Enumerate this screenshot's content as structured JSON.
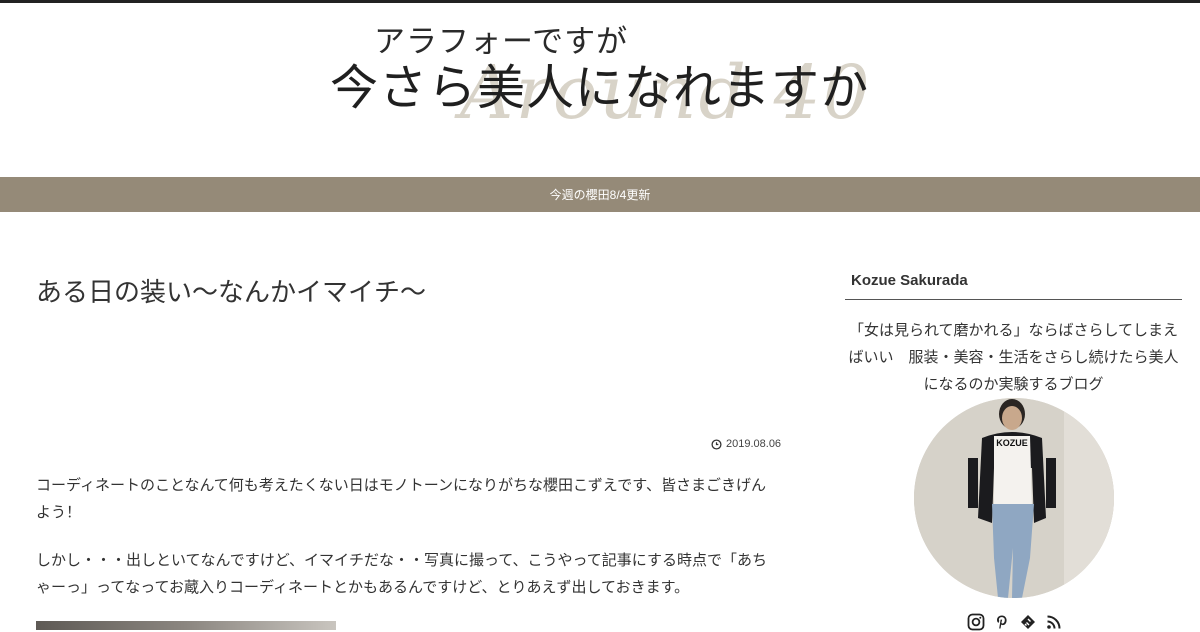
{
  "header": {
    "logo_subtitle": "アラフォーですが",
    "logo_title": "今さら美人になれますか",
    "logo_watermark": "Around 40"
  },
  "nav": {
    "items": [
      {
        "label": "今週の櫻田8/4更新"
      }
    ],
    "bg_color": "#958a78"
  },
  "article": {
    "title": "ある日の装い〜なんかイマイチ〜",
    "date": "2019.08.06",
    "paragraphs": [
      "コーディネートのことなんて何も考えたくない日はモノトーンになりがちな櫻田こずえです、皆さまごきげんよう！",
      "しかし・・・出しといてなんですけど、イマイチだな・・写真に撮って、こうやって記事にする時点で「あちゃーっ」ってなってお蔵入りコーディネートとかもあるんですけど、とりあえず出しておきます。"
    ]
  },
  "sidebar": {
    "title": "Kozue Sakurada",
    "profile_text": "「女は見られて磨かれる」ならばさらしてしまえばいい　服装・美容・生活をさらし続けたら美人になるのか実験するブログ",
    "avatar_shirt_text": "KOZUE",
    "social_icons": [
      "instagram-icon",
      "pinterest-icon",
      "feedly-icon",
      "rss-icon"
    ]
  }
}
